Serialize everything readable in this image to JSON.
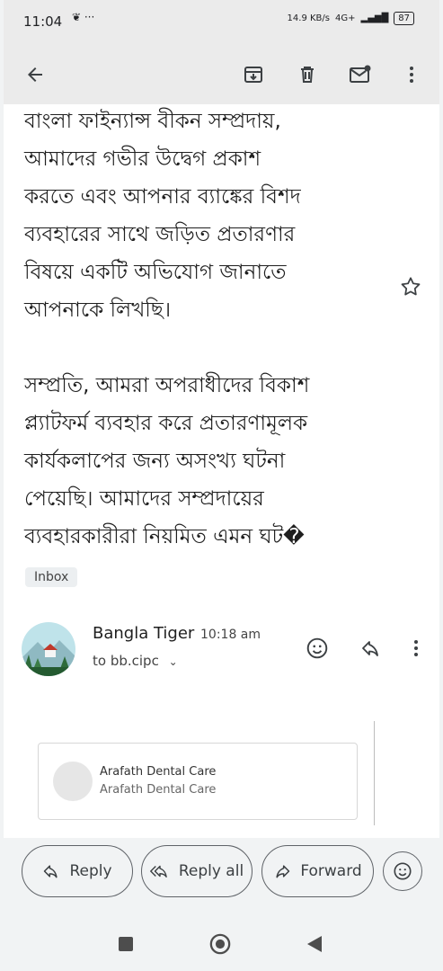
{
  "status_bar": {
    "time": "11:04",
    "icons_left": "❦ ···",
    "net_speed": "14.9 KB/s",
    "network": "4G+",
    "battery": "87"
  },
  "toolbar": {
    "back_icon": "arrow-left-icon",
    "archive_icon": "archive-icon",
    "delete_icon": "trash-icon",
    "mark_unread_icon": "mail-unread-icon",
    "more_icon": "more-vert-icon"
  },
  "message": {
    "para1_lines": [
      "বাংলা ফাইন্যান্স বীকন সম্প্রদায়,",
      "আমাদের গভীর উদ্বেগ প্রকাশ",
      "করতে এবং আপনার ব্যাঙ্কের বিশদ",
      "ব্যবহারের সাথে জড়িত প্রতারণার",
      "বিষয়ে একটি অভিযোগ জানাতে",
      "আপনাকে লিখছি।"
    ],
    "para2_lines": [
      "সম্প্রতি, আমরা অপরাধীদের বিকাশ",
      "প্ল্যাটফর্ম ব্যবহার করে প্রতারণামূলক",
      "কার্যকলাপের জন্য অসংখ্য ঘটনা",
      "পেয়েছি। আমাদের সম্প্রদায়ের",
      "ব্যবহারকারীরা নিয়মিত এমন ঘট�"
    ],
    "label_chip": "Inbox"
  },
  "sender": {
    "name": "Bangla Tiger",
    "time": "10:18 am",
    "to": "to bb.cipc"
  },
  "card": {
    "title": "Arafath Dental Care",
    "subtitle": "Arafath Dental Care"
  },
  "actions": {
    "reply": "Reply",
    "reply_all": "Reply all",
    "forward": "Forward"
  },
  "colors": {
    "toolbar_bg": "#ebebeb",
    "body_bg": "#ffffff",
    "chip_bg": "#eceff1",
    "outline": "#5f6368"
  }
}
